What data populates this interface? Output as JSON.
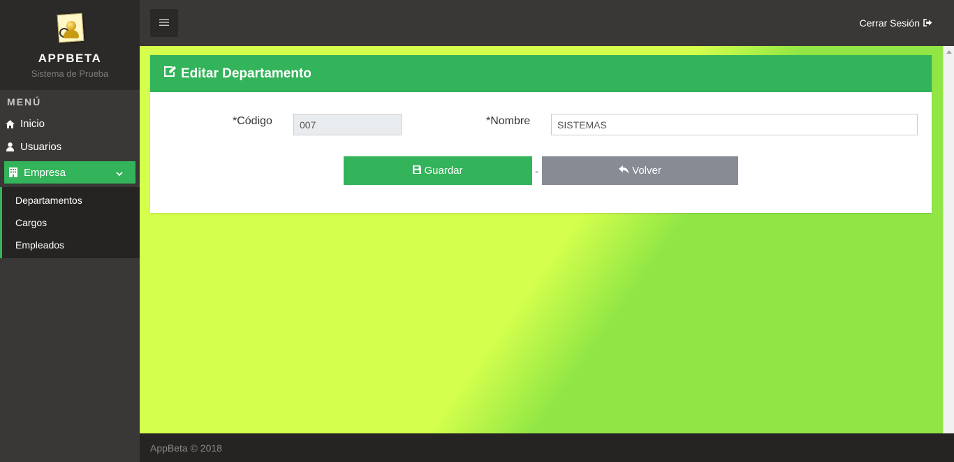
{
  "brand": {
    "title": "APPBETA",
    "subtitle": "Sistema de Prueba",
    "logo_icon": "rolodex-logo-icon"
  },
  "menu": {
    "header": "MENÚ",
    "items": [
      {
        "label": "Inicio",
        "icon": "home-icon"
      },
      {
        "label": "Usuarios",
        "icon": "user-icon"
      }
    ],
    "active": {
      "label": "Empresa",
      "icon": "building-icon",
      "expand_icon": "chevron-down-icon"
    },
    "subitems": [
      {
        "label": "Departamentos"
      },
      {
        "label": "Cargos"
      },
      {
        "label": "Empleados"
      }
    ]
  },
  "topbar": {
    "logout_label": "Cerrar Sesión",
    "logout_icon": "sign-out-icon",
    "toggle_icon": "hamburger-icon"
  },
  "panel": {
    "title": "Editar Departamento",
    "title_icon": "edit-icon",
    "codigo_label": "*Código",
    "codigo_value": "007",
    "nombre_label": "*Nombre",
    "nombre_value": "SISTEMAS",
    "save_label": "Guardar",
    "separator": "-",
    "back_label": "Volver"
  },
  "footer": {
    "text": "AppBeta © 2018"
  },
  "colors": {
    "accent": "#33b35a",
    "sidebar": "#3a3836",
    "back_button": "#878c94",
    "bg_light": "#d4ff4d",
    "bg_dark": "#91e645"
  }
}
